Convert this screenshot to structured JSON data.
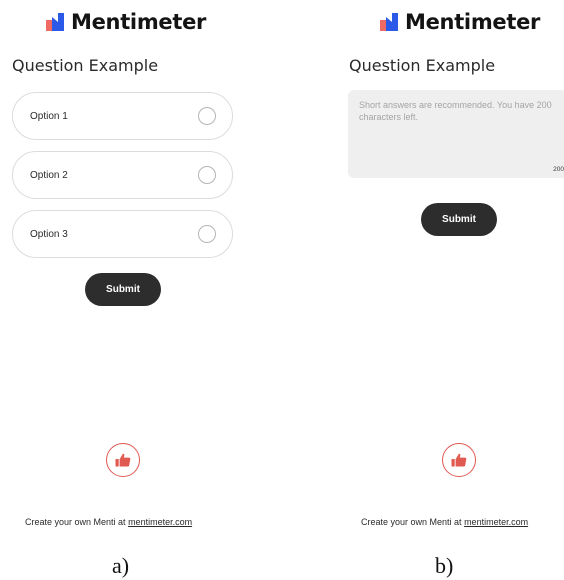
{
  "panel_a": {
    "brand": "Mentimeter",
    "question": "Question Example",
    "options": [
      "Option 1",
      "Option 2",
      "Option 3"
    ],
    "submit_label": "Submit",
    "reaction_icon": "thumbs-up-icon",
    "footer_text": "Create your own Menti at",
    "footer_link": "mentimeter.com"
  },
  "panel_b": {
    "brand": "Mentimeter",
    "question": "Question Example",
    "placeholder": "Short answers are recommended. You have 200 characters left.",
    "char_count": "200",
    "submit_label": "Submit",
    "reaction_icon": "thumbs-up-icon",
    "footer_text": "Create your own Menti at",
    "footer_link": "mentimeter.com"
  },
  "captions": {
    "a": "a)",
    "b": "b)"
  },
  "colors": {
    "accent": "#e05a52",
    "button": "#2d2d2d",
    "logo_blue": "#2b59e8",
    "logo_red": "#f06a64"
  }
}
